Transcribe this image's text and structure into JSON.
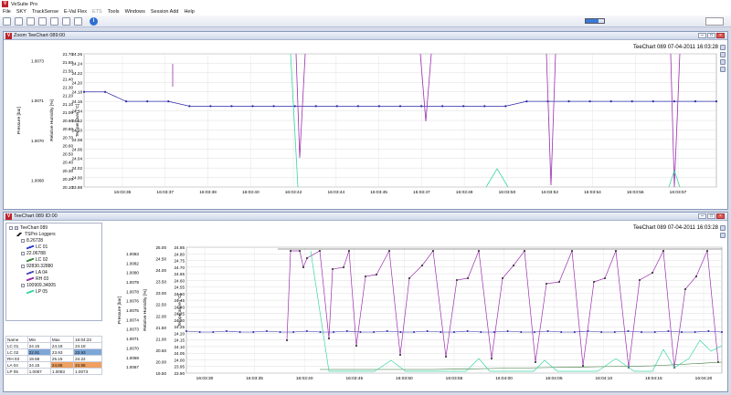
{
  "app": {
    "title": "VeSuite Pro"
  },
  "menu": [
    "File",
    "SKY",
    "TrackSense",
    "E-Val Flex",
    "ETS",
    "Tools",
    "Windows",
    "Session Add",
    "Help"
  ],
  "panels": {
    "top": {
      "title": "Zoom TeeChart 089:00",
      "stamp": "TeeChart 089 07-04-2011 16:03:28"
    },
    "bottom": {
      "title": "TeeChart 089 ID:00",
      "stamp": "TeeChart 089 07-04-2011 16:03:28"
    }
  },
  "tree": {
    "root": "TeeChart 089",
    "group": "TSPro Loggers",
    "items": [
      {
        "label": "8.26728",
        "color": "#ffffff"
      },
      {
        "label": "LC 01",
        "color": "#2d3bd6"
      },
      {
        "label": "22.06788",
        "color": "#ffffff"
      },
      {
        "label": "LC 02",
        "color": "#3c8a3c"
      },
      {
        "label": "92830.32880",
        "color": "#ffffff"
      },
      {
        "label": "LA 04",
        "color": "#4c4cc0"
      },
      {
        "label": "RH 03",
        "color": "#9b2fae"
      },
      {
        "label": "100909.34005",
        "color": "#ffffff"
      },
      {
        "label": "LP 05",
        "color": "#39d6a6"
      }
    ]
  },
  "stats": {
    "headers": [
      "Name",
      "Min",
      "Max",
      "16:04:23"
    ],
    "rows": [
      [
        "LC 01",
        "24.15",
        "24.18",
        "24.18"
      ],
      [
        "LC 02",
        "22.91",
        "23.93",
        "23.93"
      ],
      [
        "RH 03",
        "19.58",
        "25.15",
        "24.22"
      ],
      [
        "LA 04",
        "24.15",
        "24.86",
        "24.86"
      ],
      [
        "LP 05",
        "1.0067",
        "1.0083",
        "1.0073"
      ]
    ]
  },
  "colors": {
    "temp": "#2828a8",
    "rh": "#9b2fae",
    "pressure": "#39d6a6",
    "lc02": "#2f6f2f"
  },
  "chart_data": [
    {
      "type": "line",
      "title": "TeeChart 089 07-04-2011 16:03:28",
      "x": [
        "16:03:35",
        "16:03:37",
        "16:03:38",
        "16:03:40",
        "16:03:42",
        "16:03:44",
        "16:03:45",
        "16:03:47",
        "16:03:49",
        "16:03:50",
        "16:03:52",
        "16:03:54",
        "16:03:56",
        "16:03:57"
      ],
      "axes": {
        "pressure": {
          "label": "Pressure [bar]",
          "ticks": [
            "1.0073",
            "1.0071",
            "1.0070",
            "1.0068"
          ]
        },
        "rh": {
          "label": "Relative Humidity [%]",
          "ticks": [
            "21.70",
            "21.60",
            "21.50",
            "21.40",
            "21.30",
            "21.20",
            "21.10",
            "21.00",
            "20.90",
            "20.80",
            "20.70",
            "20.60",
            "20.50",
            "20.40",
            "20.30",
            "20.20",
            "20.10"
          ]
        },
        "temp": {
          "label": "Temperature [°C]",
          "ylim": [
            23.98,
            24.26
          ],
          "ticks": [
            "24.26",
            "24.24",
            "24.22",
            "24.20",
            "24.18",
            "24.16",
            "24.14",
            "24.12",
            "24.10",
            "24.08",
            "24.06",
            "24.04",
            "24.02",
            "24.00",
            "23.98"
          ]
        }
      },
      "series": [
        {
          "values": [
            24.18,
            24.18,
            24.16,
            24.16,
            24.16,
            24.15,
            24.15,
            24.15,
            24.15,
            24.15,
            24.15,
            24.15,
            24.15,
            24.15,
            24.15,
            24.15,
            24.15,
            24.15,
            24.15,
            24.15,
            24.15,
            24.16,
            24.16,
            24.16,
            24.16,
            24.16,
            24.16,
            24.16,
            24.16,
            24.16,
            24.16
          ]
        }
      ]
    },
    {
      "type": "line",
      "title": "TeeChart 089 07-04-2011 16:03:28",
      "x": [
        "16:03:30",
        "16:03:35",
        "16:03:40",
        "16:03:45",
        "16:03:50",
        "16:03:55",
        "16:04:00",
        "16:04:05",
        "16:04:10",
        "16:04:15",
        "16:04:20"
      ],
      "axes": {
        "pressure": {
          "label": "Pressure [bar]",
          "ticks": [
            "1.0083",
            "1.0082",
            "1.0080",
            "1.0079",
            "1.0078",
            "1.0076",
            "1.0075",
            "1.0074",
            "1.0073",
            "1.0071",
            "1.0070",
            "1.0069",
            "1.0067"
          ]
        },
        "rh": {
          "label": "Relative Humidity [%]",
          "ticks": [
            "25.00",
            "24.50",
            "24.00",
            "23.50",
            "23.00",
            "22.50",
            "22.00",
            "21.50",
            "21.00",
            "20.50",
            "20.00",
            "19.50"
          ]
        },
        "temp": {
          "label": "Temperature [°C]",
          "ylim": [
            23.9,
            24.85
          ],
          "ticks": [
            "24.85",
            "24.80",
            "24.75",
            "24.70",
            "24.65",
            "24.60",
            "24.55",
            "24.50",
            "24.45",
            "24.40",
            "24.35",
            "24.30",
            "24.25",
            "24.20",
            "24.15",
            "24.10",
            "24.05",
            "24.00",
            "23.95",
            "23.90"
          ]
        }
      }
    }
  ]
}
